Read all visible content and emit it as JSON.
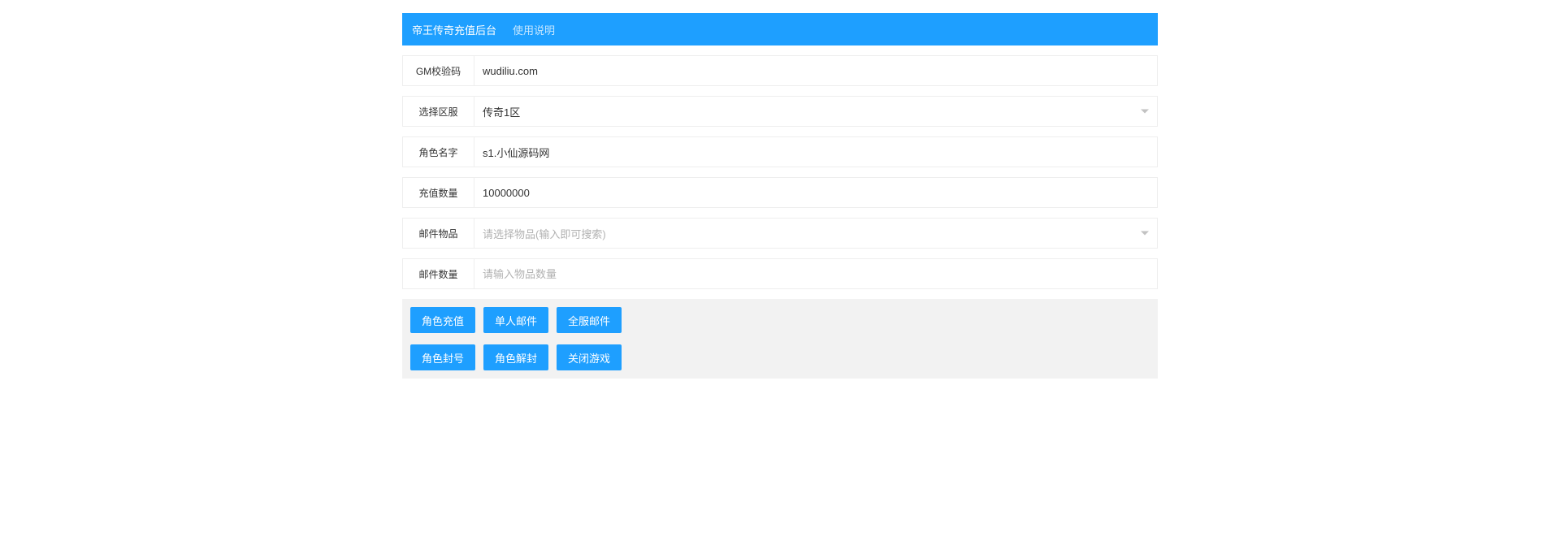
{
  "header": {
    "title": "帝王传奇充值后台",
    "usage_link": "使用说明"
  },
  "form": {
    "gm_code": {
      "label": "GM校验码",
      "value": "wudiliu.com"
    },
    "server": {
      "label": "选择区服",
      "value": "传奇1区"
    },
    "role_name": {
      "label": "角色名字",
      "value": "s1.小仙源码网"
    },
    "recharge_amount": {
      "label": "充值数量",
      "value": "10000000"
    },
    "mail_item": {
      "label": "邮件物品",
      "placeholder": "请选择物品(输入即可搜索)"
    },
    "mail_quantity": {
      "label": "邮件数量",
      "placeholder": "请输入物品数量"
    }
  },
  "buttons": {
    "role_recharge": "角色充值",
    "single_mail": "单人邮件",
    "server_mail": "全服邮件",
    "role_ban": "角色封号",
    "role_unban": "角色解封",
    "close_game": "关闭游戏"
  }
}
